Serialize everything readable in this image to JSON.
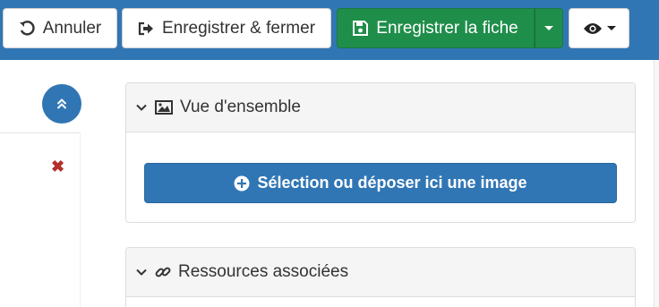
{
  "toolbar": {
    "cancel_label": "Annuler",
    "save_close_label": "Enregistrer & fermer",
    "save_label": "Enregistrer la fiche",
    "colors": {
      "bar": "#3176b4",
      "save": "#1f8e4a"
    },
    "icons": {
      "cancel": "undo-icon",
      "save_close": "sign-out-icon",
      "save": "floppy-disk-icon",
      "view": "eye-icon"
    }
  },
  "sidebar": {
    "scroll_icon": "double-chevron-up-icon",
    "remove_icon": "remove-x-icon"
  },
  "panels": [
    {
      "title": "Vue d'ensemble",
      "icon": "picture-icon",
      "upload_label": "Sélection ou déposer ici une image",
      "upload_icon": "plus-circle-icon"
    },
    {
      "title": "Ressources associées",
      "icon": "link-icon"
    }
  ]
}
